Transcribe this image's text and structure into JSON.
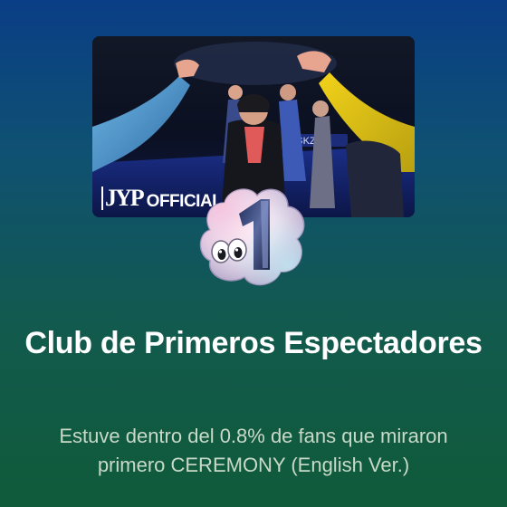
{
  "video": {
    "watermark_logo": "JYP",
    "watermark_label": "OFFICIAL",
    "sign_text": "SKZ"
  },
  "badge": {
    "number": "1",
    "icon": "first-viewer-badge-icon"
  },
  "achievement": {
    "title": "Club de Primeros Espectadores",
    "description": "Estuve dentro del 0.8% de fans que miraron primero CEREMONY (English Ver.)"
  }
}
